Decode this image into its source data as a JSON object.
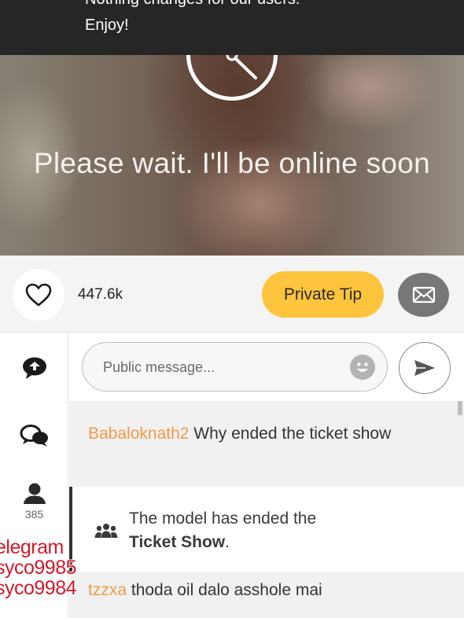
{
  "notice": {
    "line1": "Nothing changes for our users.",
    "line2": "Enjoy!"
  },
  "stream": {
    "status_text": "Please wait. I'll be online soon",
    "clock_icon": "clock-icon"
  },
  "action_bar": {
    "like_icon": "heart-icon",
    "like_count": "447.6k",
    "private_tip_label": "Private Tip",
    "message_icon": "envelope-icon"
  },
  "rail": {
    "items": [
      {
        "icon": "chat-bubble-icon"
      },
      {
        "icon": "conversations-icon"
      },
      {
        "icon": "user-icon",
        "count": "385"
      }
    ]
  },
  "chat_input": {
    "placeholder": "Public message...",
    "emoji_icon": "emoji-icon",
    "send_icon": "send-icon"
  },
  "messages": [
    {
      "user": "Babaloknath2",
      "text": "Why ended the ticket show"
    },
    {
      "system_icon": "group-icon",
      "text_prefix": "The model has ended the",
      "text_bold": "Ticket Show",
      "text_suffix": "."
    },
    {
      "user": "tzzxa",
      "text": "thoda oil dalo asshole mai"
    }
  ],
  "watermark": {
    "lines": [
      "elegram",
      "syco9985",
      "syco9984"
    ]
  },
  "colors": {
    "accent": "#ffc43d",
    "username": "#f29a48",
    "watermark": "#d2192b"
  }
}
